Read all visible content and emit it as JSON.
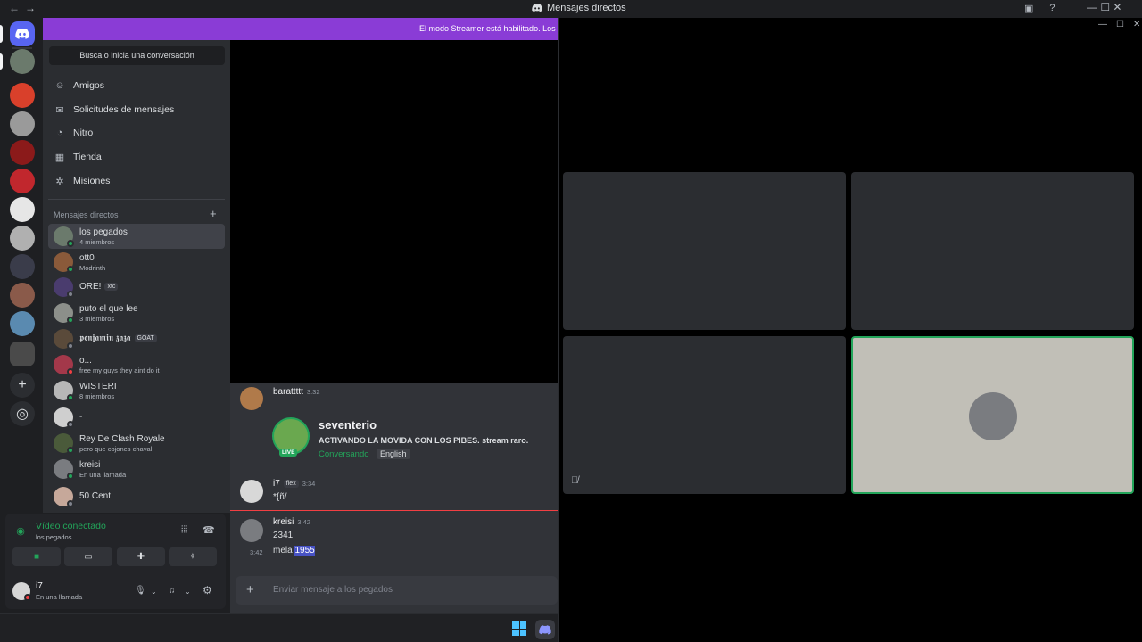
{
  "window": {
    "title": "Mensajes directos",
    "nav_glyphs": "←→",
    "controls": "—  ☐  ✕"
  },
  "banner": {
    "text": "El modo Streamer está habilitado. Los"
  },
  "sidebar": {
    "search_placeholder": "Busca o inicia una conversación",
    "nav": [
      {
        "label": "Amigos",
        "icon": "friends-icon"
      },
      {
        "label": "Solicitudes de mensajes",
        "icon": "envelope-icon"
      },
      {
        "label": "Nitro",
        "icon": "nitro-icon"
      },
      {
        "label": "Tienda",
        "icon": "shop-icon"
      },
      {
        "label": "Misiones",
        "icon": "quest-icon"
      }
    ],
    "dm_header": "Mensajes directos",
    "dms": [
      {
        "name": "los pegados",
        "sub": "4 miembros",
        "avatar_color": "#6b7a6c",
        "status": "#23a55a"
      },
      {
        "name": "ott0",
        "sub": "Modrinth",
        "avatar_color": "#8a5a3a",
        "status": "#23a55a"
      },
      {
        "name": "ORE!",
        "tag": "xtc",
        "avatar_color": "#4a3c6e",
        "status": "#80848e"
      },
      {
        "name": "puto el que lee",
        "sub": "3 miembros",
        "avatar_color": "#8c8f8a",
        "status": "#23a55a"
      },
      {
        "name": "𝖕𝖊𝖓𝖏𝖆𝖒𝖎𝖓 𝖟𝖆𝖟𝖆",
        "tag": "GOAT",
        "avatar_color": "#5a4a3a",
        "status": "#80848e"
      },
      {
        "name": "o...",
        "sub": "free my guys they aint do it",
        "avatar_color": "#a3384a",
        "status": "#f23f43"
      },
      {
        "name": "WISTERI",
        "sub": "8 miembros",
        "avatar_color": "#b7b7b7",
        "status": "#23a55a"
      },
      {
        "name": "-",
        "avatar_color": "#cfcfcf",
        "status": "#80848e"
      },
      {
        "name": "Rey De Clash Royale",
        "sub": "pero que cojones chaval",
        "avatar_color": "#4a5a3a",
        "status": "#23a55a"
      },
      {
        "name": "kreisi",
        "sub": "En una llamada",
        "avatar_color": "#7a7c80",
        "status": "#23a55a"
      },
      {
        "name": "50 Cent",
        "avatar_color": "#c6a89a",
        "status": "#80848e"
      }
    ]
  },
  "voice_panel": {
    "title": "Vídeo conectado",
    "channel": "los pegados",
    "user_name": "i7",
    "user_status": "En una llamada"
  },
  "chat": {
    "messages": [
      {
        "author": "barattttt",
        "time": "3:32"
      },
      {
        "author": "i7",
        "badge": "flex",
        "time": "3:34",
        "text": "*{ñ/"
      },
      {
        "author": "kreisi",
        "time": "3:42",
        "text": "2341"
      }
    ],
    "followup": {
      "time": "3:42",
      "text": "mela ",
      "highlight": "1955"
    },
    "embed": {
      "title": "seventerio",
      "description": "ACTIVANDO LA MOVIDA CON LOS PIBES. stream raro.",
      "status": "Conversando",
      "language": "English",
      "live_label": "LIVE"
    },
    "composer_placeholder": "Enviar mensaje a los pegados"
  },
  "colors": {
    "accent": "#5865f2",
    "green": "#23a55a",
    "red": "#f23f43",
    "banner": "#8a3cd6"
  }
}
